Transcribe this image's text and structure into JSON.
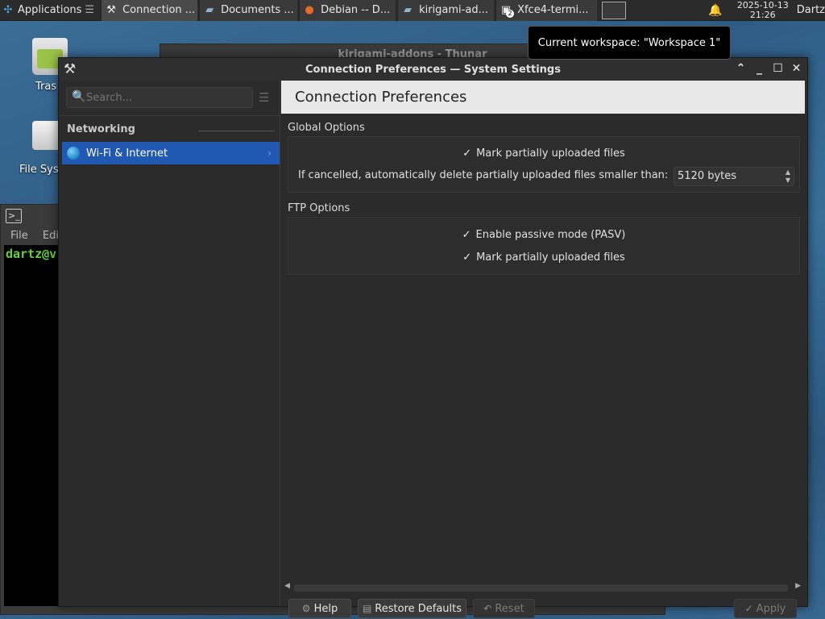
{
  "taskbar": {
    "apps_label": "Applications",
    "tasks": [
      {
        "label": "Connection ...",
        "icon": "tools-icon"
      },
      {
        "label": "Documents ...",
        "icon": "folder-icon"
      },
      {
        "label": "Debian -- D...",
        "icon": "firefox-icon"
      },
      {
        "label": "kirigami-ad...",
        "icon": "folder-icon"
      },
      {
        "label": "Xfce4-termi...",
        "icon": "terminal-icon",
        "badge": "2"
      }
    ],
    "date": "2025-10-13",
    "time": "21:26",
    "user": "Dartz"
  },
  "tooltip": {
    "text": "Current workspace: \"Workspace 1\""
  },
  "desktop": {
    "trash_label": "Tras",
    "filesystem_label": "File Sys"
  },
  "terminal": {
    "menu_file": "File",
    "menu_edit": "Edi",
    "prompt": "dartz@v"
  },
  "thunar": {
    "title": "kirigami-addons - Thunar"
  },
  "window": {
    "title": "Connection Preferences  — System Settings"
  },
  "sidebar": {
    "search_placeholder": "Search...",
    "group_label": "Networking",
    "items": [
      {
        "label": "Wi-Fi & Internet"
      }
    ]
  },
  "page": {
    "header": "Connection Preferences",
    "global_title": "Global Options",
    "global_mark_partial": "Mark partially uploaded files",
    "delete_label": "If cancelled, automatically delete partially uploaded files smaller than:",
    "delete_value": "5120 bytes",
    "ftp_title": "FTP Options",
    "ftp_passive": "Enable passive mode (PASV)",
    "ftp_mark_partial": "Mark partially uploaded files"
  },
  "buttons": {
    "help": "Help",
    "restore": "Restore Defaults",
    "reset": "Reset",
    "apply": "Apply"
  }
}
